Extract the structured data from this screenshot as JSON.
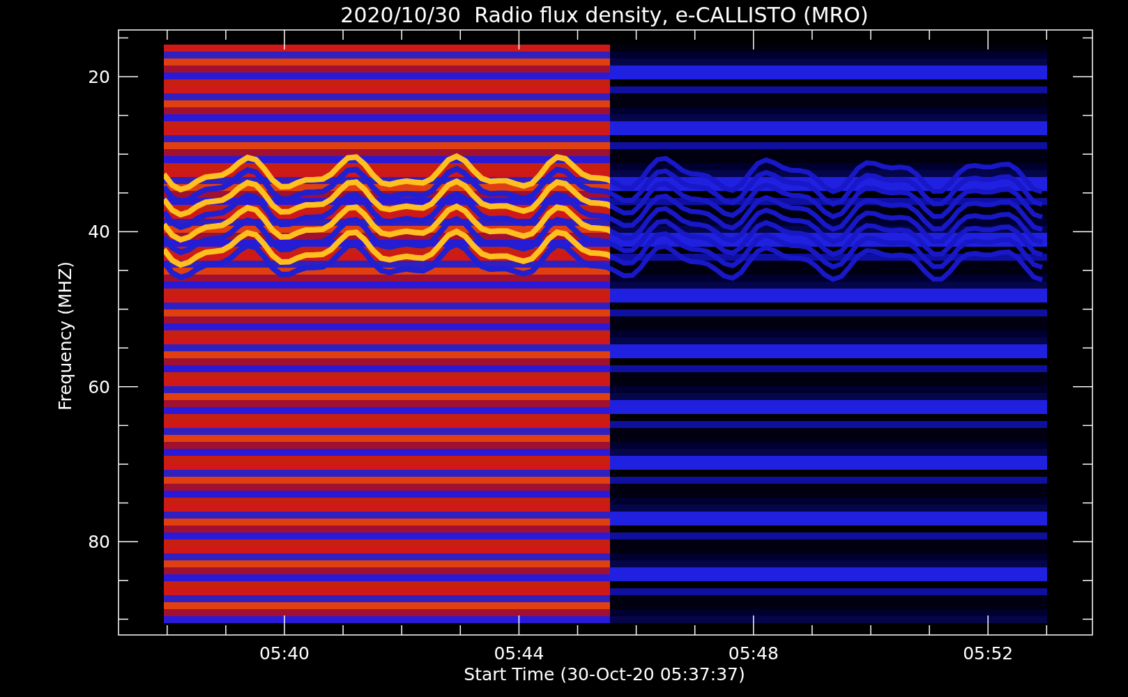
{
  "title": "2020/10/30  Radio flux density, e-CALLISTO (MRO)",
  "plot": {
    "ylabel": "Frequency (MHZ)",
    "xlabel": "Start Time (30-Oct-20 05:37:37)",
    "yticks": [
      "20",
      "40",
      "60",
      "80"
    ],
    "xticks": [
      "05:40",
      "05:44",
      "05:48",
      "05:52"
    ]
  }
}
